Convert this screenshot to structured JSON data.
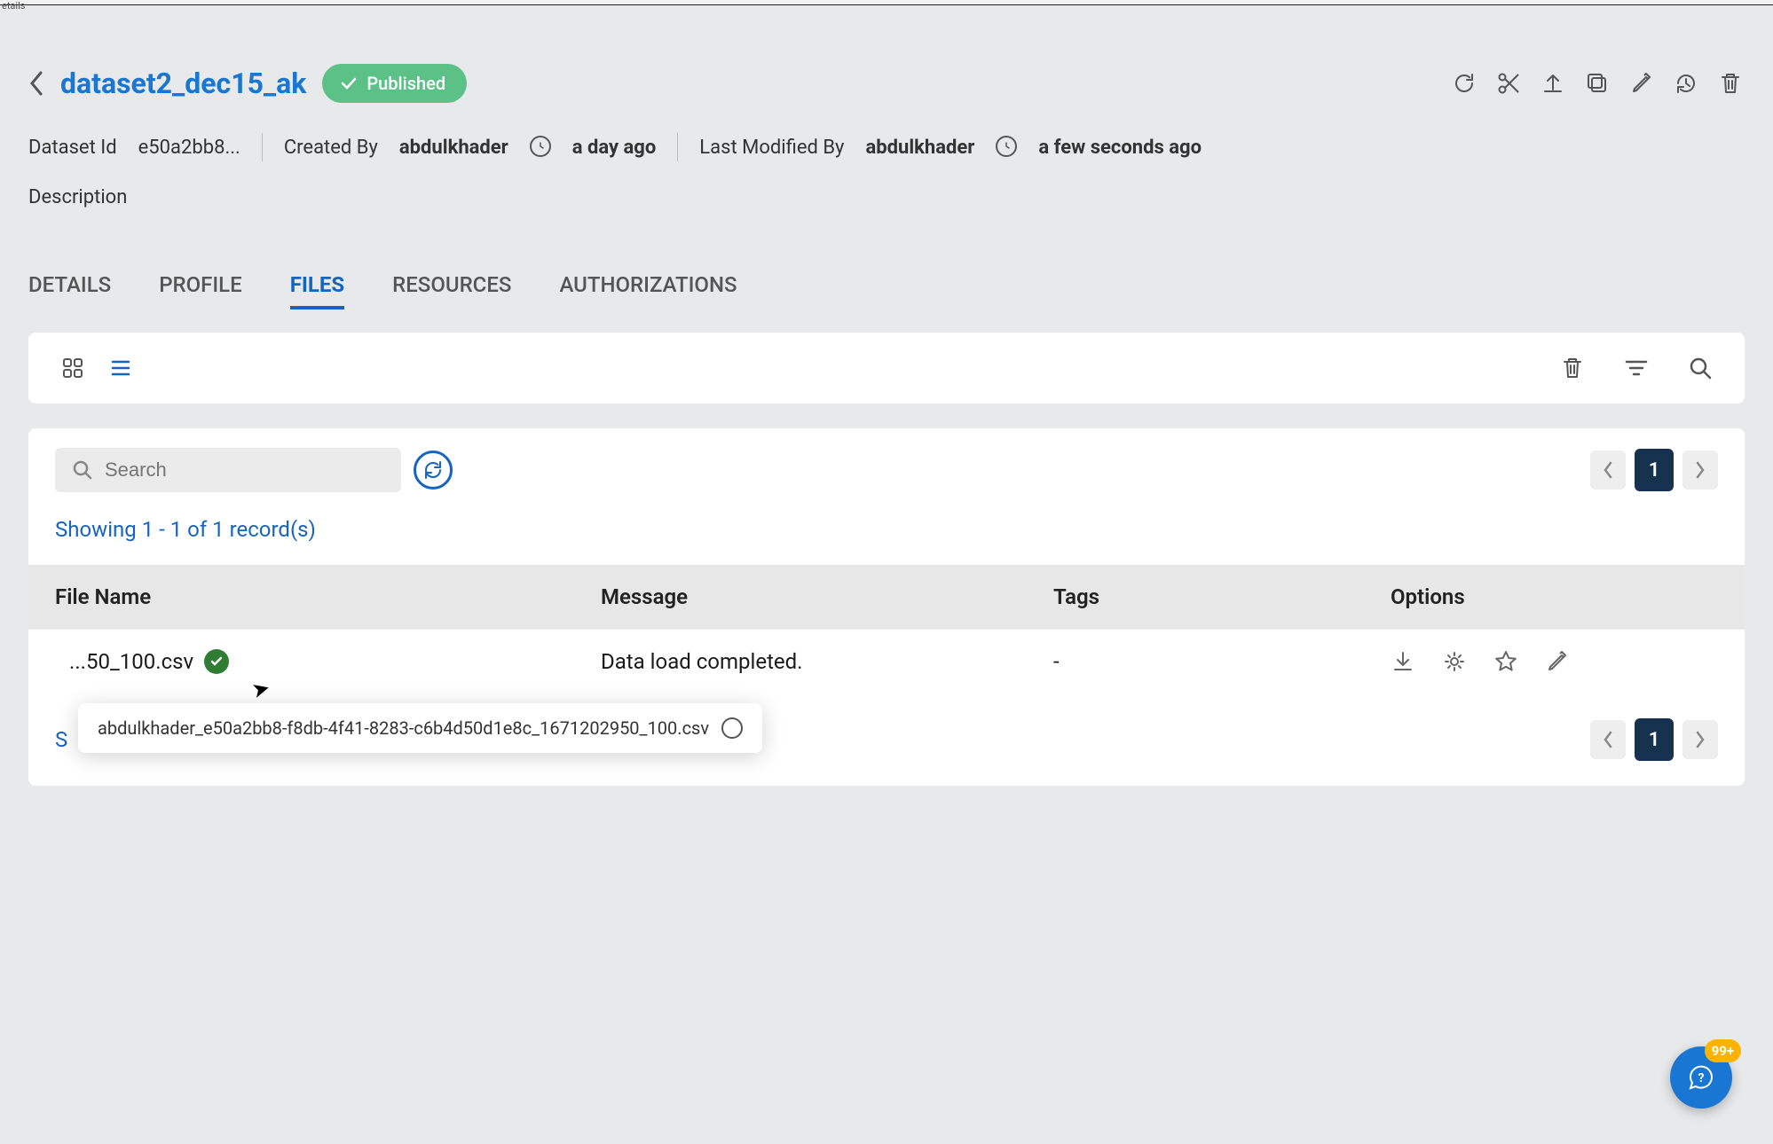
{
  "topbar_fragment": "etails",
  "header": {
    "title": "dataset2_dec15_ak",
    "status": "Published"
  },
  "meta": {
    "dataset_id_label": "Dataset Id",
    "dataset_id_value": "e50a2bb8...",
    "created_by_label": "Created By",
    "created_by_user": "abdulkhader",
    "created_time": "a day ago",
    "modified_by_label": "Last Modified By",
    "modified_by_user": "abdulkhader",
    "modified_time": "a few seconds ago",
    "description_label": "Description"
  },
  "tabs": {
    "items": [
      "DETAILS",
      "PROFILE",
      "FILES",
      "RESOURCES",
      "AUTHORIZATIONS"
    ],
    "active": "FILES"
  },
  "files": {
    "search_placeholder": "Search",
    "records_text": "Showing 1 - 1 of 1 record(s)",
    "records_text_bottom_partial": "S",
    "columns": [
      "File Name",
      "Message",
      "Tags",
      "Options"
    ],
    "rows": [
      {
        "name": "...50_100.csv",
        "message": "Data load completed.",
        "tags": "-"
      }
    ],
    "page_current": "1",
    "tooltip_full_name": "abdulkhader_e50a2bb8-f8db-4f41-8283-c6b4d50d1e8c_1671202950_100.csv"
  },
  "help": {
    "badge": "99+"
  }
}
